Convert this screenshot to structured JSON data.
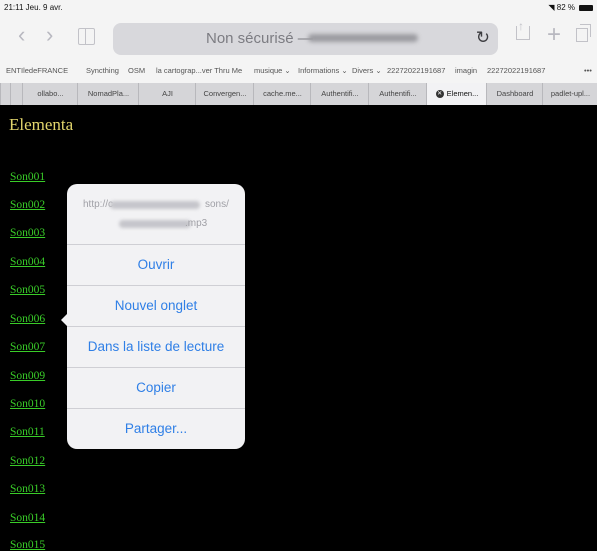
{
  "status": {
    "time": "21:11",
    "date": "Jeu. 9 avr.",
    "battery": "82 %"
  },
  "toolbar": {
    "address_text": "Non sécurisé —",
    "icons": [
      "back-icon",
      "forward-icon",
      "bookmarks-icon",
      "reload-icon",
      "share-icon",
      "new-tab-icon",
      "tabs-icon"
    ]
  },
  "favorites": [
    "ENTIledeFRANCE",
    "Syncthing",
    "OSM",
    "la cartograp...ver Thru Me",
    "musique ⌄",
    "Informations ⌄",
    "Divers ⌄",
    "22272022191687",
    "imagin",
    "22272022191687",
    "•••"
  ],
  "tabs": [
    "ollabo...",
    "NomadPla...",
    "AJI",
    "Convergen...",
    "cache.me...",
    "Authentifi...",
    "Authentifi...",
    "Elemen...",
    "Dashboard",
    "padlet-upl..."
  ],
  "page": {
    "title": "Elementa",
    "links": [
      "Son001",
      "Son002",
      "Son003",
      "Son004",
      "Son005",
      "Son006",
      "Son007",
      "Son009",
      "Son010",
      "Son011",
      "Son012",
      "Son013",
      "Son014",
      "Son015"
    ]
  },
  "popover": {
    "url_line1_start": "http://c",
    "url_line1_end": "sons/",
    "url_line2_end": ".mp3",
    "actions": [
      "Ouvrir",
      "Nouvel onglet",
      "Dans la liste de lecture",
      "Copier",
      "Partager..."
    ]
  }
}
